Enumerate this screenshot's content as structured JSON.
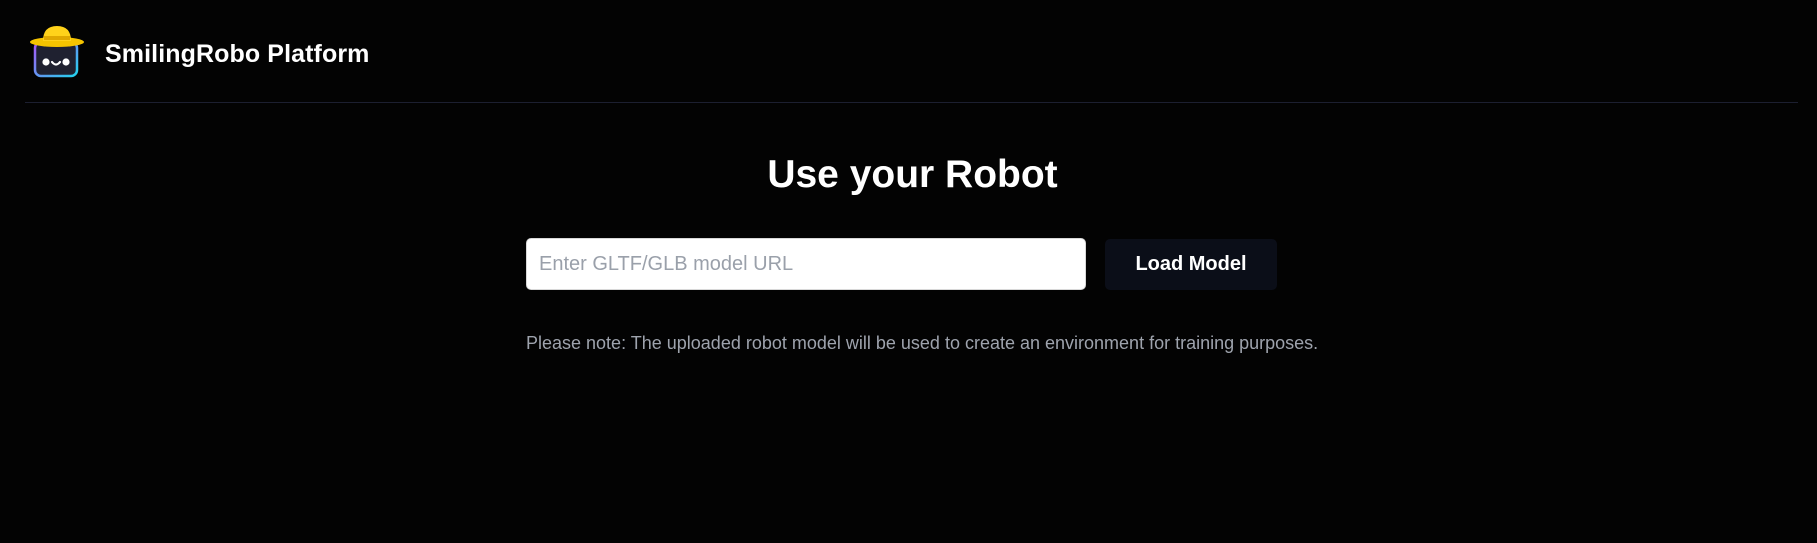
{
  "header": {
    "brand_title": "SmilingRobo Platform",
    "logo_icon": "robot-with-hat-icon"
  },
  "main": {
    "title": "Use your Robot",
    "url_input": {
      "value": "",
      "placeholder": "Enter GLTF/GLB model URL"
    },
    "load_button_label": "Load Model",
    "note": "Please note: The uploaded robot model will be used to create an environment for training purposes."
  },
  "colors": {
    "background": "#030303",
    "divider": "#1c1f30",
    "button_bg": "#0b0e18",
    "note_text": "#9ea3ad",
    "logo_hat": "#ffd21a",
    "logo_body": "#2a2a3a"
  }
}
